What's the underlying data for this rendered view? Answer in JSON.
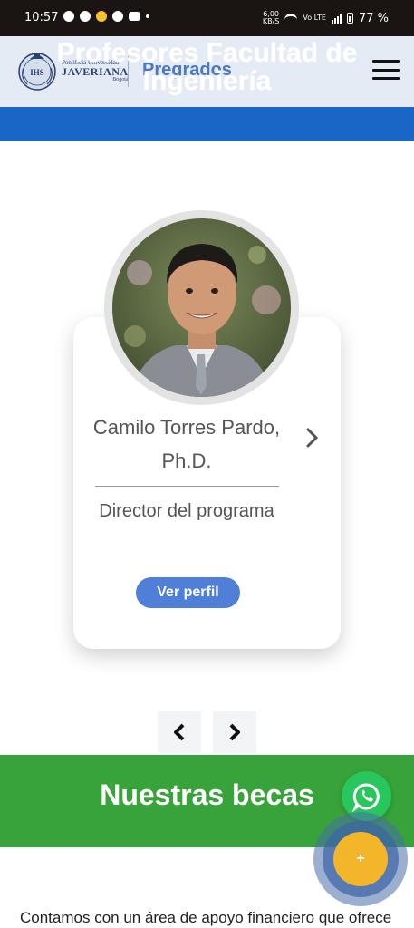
{
  "status_bar": {
    "time": "10:57",
    "network_speed_value": "6,00",
    "network_speed_unit": "KB/S",
    "network_type": "Vo LTE",
    "battery": "77 %",
    "icons": [
      "snapchat-icon",
      "facebook-icon",
      "notification-app-icon",
      "pinterest-icon",
      "youtube-icon",
      "more-dot-icon",
      "wifi-icon",
      "signal-icon",
      "battery-icon"
    ]
  },
  "header": {
    "logo": {
      "line1": "Pontificia Universidad",
      "line2": "JAVERIANA",
      "line3": "Bogotá",
      "seal_text": "IHS"
    },
    "section_link": "Pregrados",
    "page_title": "Profesores Facultad de Ingeniería"
  },
  "profile_card": {
    "name": "Camilo Torres Pardo, Ph.D.",
    "role": "Director del programa",
    "button_label": "Ver perfil"
  },
  "scholarships": {
    "title": "Nuestras becas",
    "intro": "Contamos con un área de apoyo financiero que ofrece"
  },
  "fab": {
    "label": "+"
  },
  "colors": {
    "header_bg": "#e4ebf4",
    "brand_blue": "#1a66c6",
    "link_blue": "#4a78c2",
    "button_blue": "#4f7fd6",
    "green": "#38a33a",
    "whatsapp_green": "#29c55d",
    "fab_yellow": "#f3b52a"
  }
}
